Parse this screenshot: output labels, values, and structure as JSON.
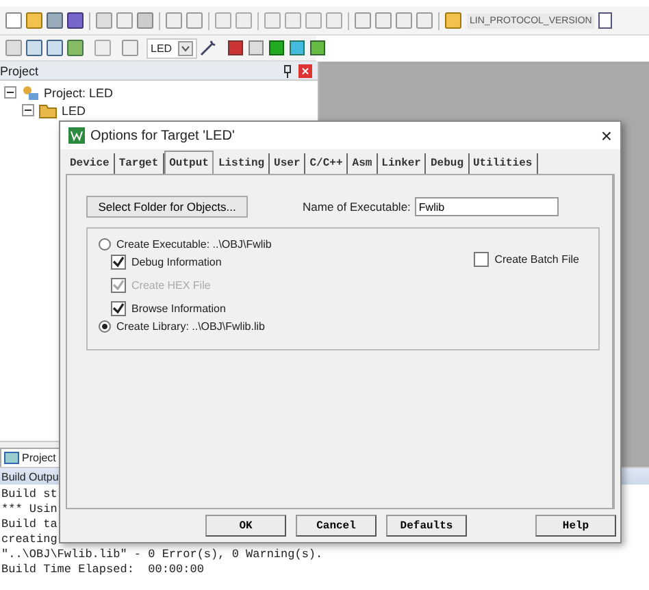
{
  "toolbar": {
    "config_combo": "LIN_PROTOCOL_VERSION"
  },
  "build_toolbar": {
    "target_combo": "LED"
  },
  "project_panel": {
    "title": "Project",
    "tree": [
      {
        "label": "Project: LED",
        "expanded": true,
        "children": [
          {
            "label": "LED",
            "expanded": true
          }
        ]
      }
    ],
    "tab": "Project"
  },
  "build_output": {
    "title": "Build Outpu",
    "lines": [
      "Build st",
      "*** Usin",
      "Build ta",
      "creating",
      "\"..\\OBJ\\Fwlib.lib\" - 0 Error(s), 0 Warning(s).",
      "Build Time Elapsed:  00:00:00"
    ]
  },
  "dialog": {
    "title": "Options for Target 'LED'",
    "close": "×",
    "tabs": [
      {
        "label": "Device",
        "selected": false
      },
      {
        "label": "Target",
        "selected": false
      },
      {
        "label": "Output",
        "selected": true
      },
      {
        "label": "Listing",
        "selected": false
      },
      {
        "label": "User",
        "selected": false
      },
      {
        "label": "C/C++",
        "selected": false
      },
      {
        "label": "Asm",
        "selected": false
      },
      {
        "label": "Linker",
        "selected": false
      },
      {
        "label": "Debug",
        "selected": false
      },
      {
        "label": "Utilities",
        "selected": false
      }
    ],
    "select_folder_button": "Select Folder for Objects...",
    "name_label": "Name of Executable:",
    "name_value": "Fwlib",
    "create_executable": {
      "label": "Create Executable:  ..\\OBJ\\Fwlib",
      "selected": false
    },
    "options": [
      {
        "label": "Debug Information",
        "checked": true,
        "disabled": false
      },
      {
        "label": "Create HEX File",
        "checked": true,
        "disabled": true
      },
      {
        "label": "Browse Information",
        "checked": true,
        "disabled": false
      }
    ],
    "batch_file": {
      "label": "Create Batch File",
      "checked": false
    },
    "create_library": {
      "label": "Create Library:  ..\\OBJ\\Fwlib.lib",
      "selected": true
    },
    "buttons": [
      "OK",
      "Cancel",
      "Defaults",
      "Help"
    ]
  }
}
